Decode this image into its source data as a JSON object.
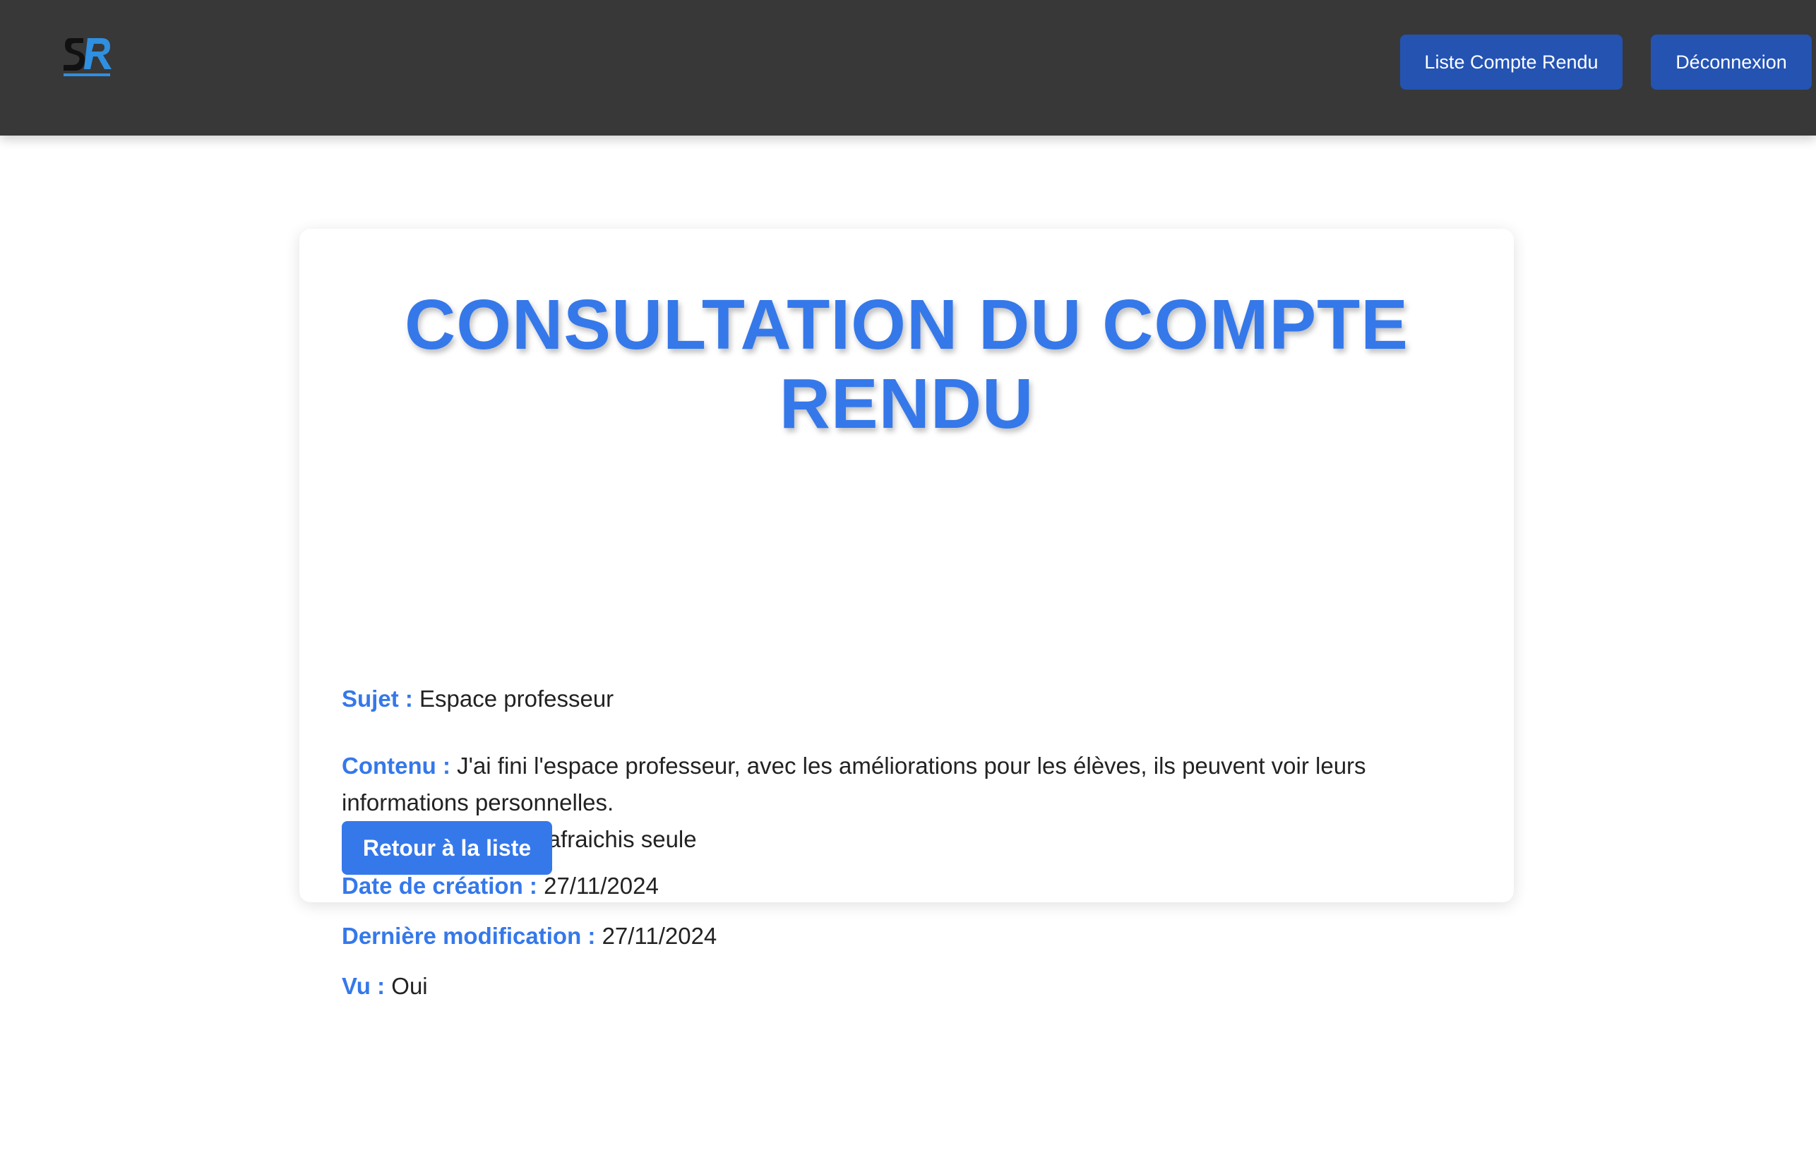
{
  "header": {
    "logo_icon": "sr-logo-icon",
    "logo_colors": {
      "dark": "#111111",
      "accent": "#2f8fe0"
    },
    "nav": {
      "list_label": "Liste Compte Rendu",
      "logout_label": "Déconnexion"
    },
    "background": "#383838",
    "button_color": "#2453b2"
  },
  "report": {
    "title": "CONSULTATION DU COMPTE RENDU",
    "accent_color": "#3578ea",
    "fields": {
      "sujet": {
        "label": "Sujet :",
        "value": "Espace professeur"
      },
      "contenu": {
        "label": "Contenu :",
        "value_line1": "J'ai fini l'espace professeur, avec les améliorations pour les élèves, ils peuvent voir leurs informations personnelles.",
        "value_line2": "En plus la page se rafraichis seule"
      },
      "date_creation": {
        "label": "Date de création :",
        "value": "27/11/2024"
      },
      "derniere_modification": {
        "label": "Dernière modification :",
        "value": "27/11/2024"
      },
      "vu": {
        "label": "Vu :",
        "value": "Oui"
      }
    },
    "back_button_label": "Retour à la liste"
  }
}
